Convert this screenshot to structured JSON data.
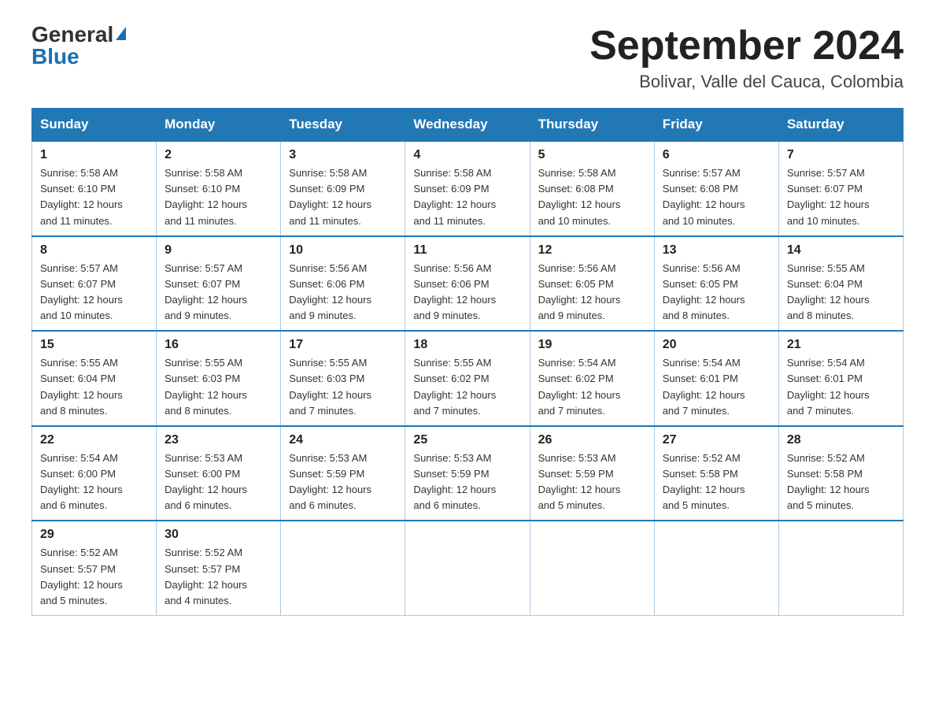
{
  "logo": {
    "general": "General",
    "triangle": "▲",
    "blue": "Blue"
  },
  "title": "September 2024",
  "subtitle": "Bolivar, Valle del Cauca, Colombia",
  "days_of_week": [
    "Sunday",
    "Monday",
    "Tuesday",
    "Wednesday",
    "Thursday",
    "Friday",
    "Saturday"
  ],
  "weeks": [
    [
      {
        "day": "1",
        "sunrise": "5:58 AM",
        "sunset": "6:10 PM",
        "daylight": "12 hours and 11 minutes."
      },
      {
        "day": "2",
        "sunrise": "5:58 AM",
        "sunset": "6:10 PM",
        "daylight": "12 hours and 11 minutes."
      },
      {
        "day": "3",
        "sunrise": "5:58 AM",
        "sunset": "6:09 PM",
        "daylight": "12 hours and 11 minutes."
      },
      {
        "day": "4",
        "sunrise": "5:58 AM",
        "sunset": "6:09 PM",
        "daylight": "12 hours and 11 minutes."
      },
      {
        "day": "5",
        "sunrise": "5:58 AM",
        "sunset": "6:08 PM",
        "daylight": "12 hours and 10 minutes."
      },
      {
        "day": "6",
        "sunrise": "5:57 AM",
        "sunset": "6:08 PM",
        "daylight": "12 hours and 10 minutes."
      },
      {
        "day": "7",
        "sunrise": "5:57 AM",
        "sunset": "6:07 PM",
        "daylight": "12 hours and 10 minutes."
      }
    ],
    [
      {
        "day": "8",
        "sunrise": "5:57 AM",
        "sunset": "6:07 PM",
        "daylight": "12 hours and 10 minutes."
      },
      {
        "day": "9",
        "sunrise": "5:57 AM",
        "sunset": "6:07 PM",
        "daylight": "12 hours and 9 minutes."
      },
      {
        "day": "10",
        "sunrise": "5:56 AM",
        "sunset": "6:06 PM",
        "daylight": "12 hours and 9 minutes."
      },
      {
        "day": "11",
        "sunrise": "5:56 AM",
        "sunset": "6:06 PM",
        "daylight": "12 hours and 9 minutes."
      },
      {
        "day": "12",
        "sunrise": "5:56 AM",
        "sunset": "6:05 PM",
        "daylight": "12 hours and 9 minutes."
      },
      {
        "day": "13",
        "sunrise": "5:56 AM",
        "sunset": "6:05 PM",
        "daylight": "12 hours and 8 minutes."
      },
      {
        "day": "14",
        "sunrise": "5:55 AM",
        "sunset": "6:04 PM",
        "daylight": "12 hours and 8 minutes."
      }
    ],
    [
      {
        "day": "15",
        "sunrise": "5:55 AM",
        "sunset": "6:04 PM",
        "daylight": "12 hours and 8 minutes."
      },
      {
        "day": "16",
        "sunrise": "5:55 AM",
        "sunset": "6:03 PM",
        "daylight": "12 hours and 8 minutes."
      },
      {
        "day": "17",
        "sunrise": "5:55 AM",
        "sunset": "6:03 PM",
        "daylight": "12 hours and 7 minutes."
      },
      {
        "day": "18",
        "sunrise": "5:55 AM",
        "sunset": "6:02 PM",
        "daylight": "12 hours and 7 minutes."
      },
      {
        "day": "19",
        "sunrise": "5:54 AM",
        "sunset": "6:02 PM",
        "daylight": "12 hours and 7 minutes."
      },
      {
        "day": "20",
        "sunrise": "5:54 AM",
        "sunset": "6:01 PM",
        "daylight": "12 hours and 7 minutes."
      },
      {
        "day": "21",
        "sunrise": "5:54 AM",
        "sunset": "6:01 PM",
        "daylight": "12 hours and 7 minutes."
      }
    ],
    [
      {
        "day": "22",
        "sunrise": "5:54 AM",
        "sunset": "6:00 PM",
        "daylight": "12 hours and 6 minutes."
      },
      {
        "day": "23",
        "sunrise": "5:53 AM",
        "sunset": "6:00 PM",
        "daylight": "12 hours and 6 minutes."
      },
      {
        "day": "24",
        "sunrise": "5:53 AM",
        "sunset": "5:59 PM",
        "daylight": "12 hours and 6 minutes."
      },
      {
        "day": "25",
        "sunrise": "5:53 AM",
        "sunset": "5:59 PM",
        "daylight": "12 hours and 6 minutes."
      },
      {
        "day": "26",
        "sunrise": "5:53 AM",
        "sunset": "5:59 PM",
        "daylight": "12 hours and 5 minutes."
      },
      {
        "day": "27",
        "sunrise": "5:52 AM",
        "sunset": "5:58 PM",
        "daylight": "12 hours and 5 minutes."
      },
      {
        "day": "28",
        "sunrise": "5:52 AM",
        "sunset": "5:58 PM",
        "daylight": "12 hours and 5 minutes."
      }
    ],
    [
      {
        "day": "29",
        "sunrise": "5:52 AM",
        "sunset": "5:57 PM",
        "daylight": "12 hours and 5 minutes."
      },
      {
        "day": "30",
        "sunrise": "5:52 AM",
        "sunset": "5:57 PM",
        "daylight": "12 hours and 4 minutes."
      },
      null,
      null,
      null,
      null,
      null
    ]
  ]
}
